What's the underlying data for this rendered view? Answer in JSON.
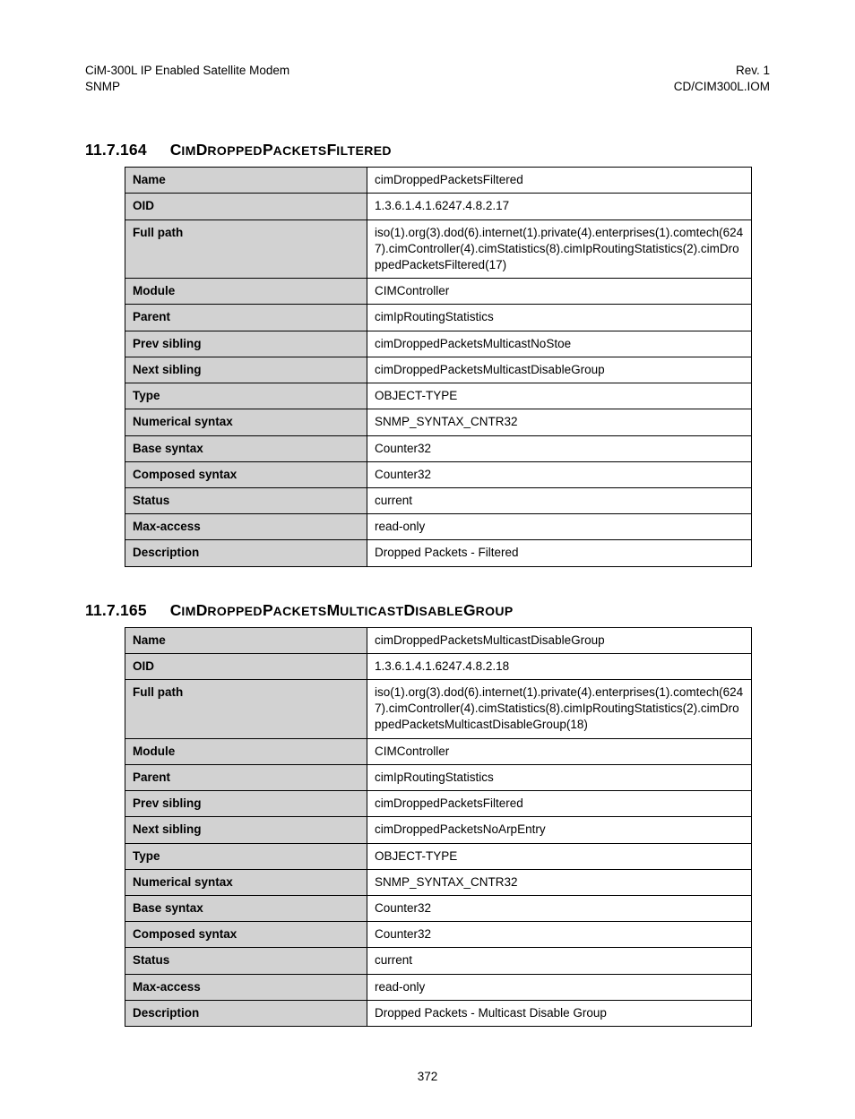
{
  "header": {
    "left_line1": "CiM-300L IP Enabled Satellite Modem",
    "left_line2": "SNMP",
    "right_line1": "Rev. 1",
    "right_line2": "CD/CIM300L.IOM"
  },
  "sections": [
    {
      "number": "11.7.164",
      "title_parts": [
        {
          "first": "C",
          "rest": "IM"
        },
        {
          "first": "D",
          "rest": "ROPPED"
        },
        {
          "first": "P",
          "rest": "ACKETS"
        },
        {
          "first": "F",
          "rest": "ILTERED"
        }
      ],
      "rows": [
        {
          "k": "Name",
          "v": "cimDroppedPacketsFiltered"
        },
        {
          "k": "OID",
          "v": "1.3.6.1.4.1.6247.4.8.2.17"
        },
        {
          "k": "Full path",
          "v": "iso(1).org(3).dod(6).internet(1).private(4).enterprises(1).comtech(6247).cimController(4).cimStatistics(8).cimIpRoutingStatistics(2).cimDroppedPacketsFiltered(17)"
        },
        {
          "k": "Module",
          "v": "CIMController"
        },
        {
          "k": "Parent",
          "v": "cimIpRoutingStatistics"
        },
        {
          "k": "Prev sibling",
          "v": "cimDroppedPacketsMulticastNoStoe"
        },
        {
          "k": "Next sibling",
          "v": "cimDroppedPacketsMulticastDisableGroup"
        },
        {
          "k": "Type",
          "v": "OBJECT-TYPE"
        },
        {
          "k": "Numerical syntax",
          "v": "SNMP_SYNTAX_CNTR32"
        },
        {
          "k": "Base syntax",
          "v": "Counter32"
        },
        {
          "k": "Composed syntax",
          "v": "Counter32"
        },
        {
          "k": "Status",
          "v": "current"
        },
        {
          "k": "Max-access",
          "v": "read-only"
        },
        {
          "k": "Description",
          "v": "Dropped Packets - Filtered"
        }
      ]
    },
    {
      "number": "11.7.165",
      "title_parts": [
        {
          "first": "C",
          "rest": "IM"
        },
        {
          "first": "D",
          "rest": "ROPPED"
        },
        {
          "first": "P",
          "rest": "ACKETS"
        },
        {
          "first": "M",
          "rest": "ULTICAST"
        },
        {
          "first": "D",
          "rest": "ISABLE"
        },
        {
          "first": "G",
          "rest": "ROUP"
        }
      ],
      "rows": [
        {
          "k": "Name",
          "v": "cimDroppedPacketsMulticastDisableGroup"
        },
        {
          "k": "OID",
          "v": "1.3.6.1.4.1.6247.4.8.2.18"
        },
        {
          "k": "Full path",
          "v": "iso(1).org(3).dod(6).internet(1).private(4).enterprises(1).comtech(6247).cimController(4).cimStatistics(8).cimIpRoutingStatistics(2).cimDroppedPacketsMulticastDisableGroup(18)"
        },
        {
          "k": "Module",
          "v": "CIMController"
        },
        {
          "k": "Parent",
          "v": "cimIpRoutingStatistics"
        },
        {
          "k": "Prev sibling",
          "v": "cimDroppedPacketsFiltered"
        },
        {
          "k": "Next sibling",
          "v": "cimDroppedPacketsNoArpEntry"
        },
        {
          "k": "Type",
          "v": "OBJECT-TYPE"
        },
        {
          "k": "Numerical syntax",
          "v": "SNMP_SYNTAX_CNTR32"
        },
        {
          "k": "Base syntax",
          "v": "Counter32"
        },
        {
          "k": "Composed syntax",
          "v": "Counter32"
        },
        {
          "k": "Status",
          "v": "current"
        },
        {
          "k": "Max-access",
          "v": "read-only"
        },
        {
          "k": "Description",
          "v": "Dropped Packets - Multicast Disable Group"
        }
      ]
    }
  ],
  "page_number": "372"
}
